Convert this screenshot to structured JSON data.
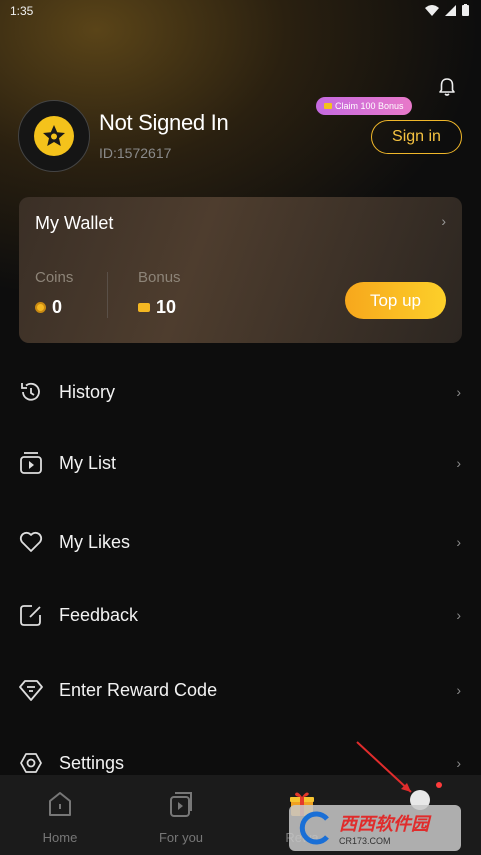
{
  "status": {
    "time": "1:35"
  },
  "profile": {
    "name": "Not Signed In",
    "id": "ID:1572617",
    "claim_badge": "Claim 100 Bonus",
    "signin_label": "Sign in"
  },
  "wallet": {
    "title": "My Wallet",
    "coins_label": "Coins",
    "coins_value": "0",
    "bonus_label": "Bonus",
    "bonus_value": "10",
    "topup_label": "Top up"
  },
  "menu": [
    {
      "label": "History",
      "icon": "history-icon"
    },
    {
      "label": "My List",
      "icon": "my-list-icon"
    },
    {
      "label": "My Likes",
      "icon": "heart-icon"
    },
    {
      "label": "Feedback",
      "icon": "feedback-icon"
    },
    {
      "label": "Enter Reward Code",
      "icon": "reward-code-icon"
    },
    {
      "label": "Settings",
      "icon": "settings-icon"
    }
  ],
  "nav": {
    "home": "Home",
    "for_you": "For you",
    "rewards": "Rewa"
  },
  "watermark": {
    "brand": "西西软件园",
    "domain": "CR173.COM"
  },
  "colors": {
    "accent": "#f6c341",
    "topup": "#fcd02a",
    "badge": "#d873d6"
  }
}
